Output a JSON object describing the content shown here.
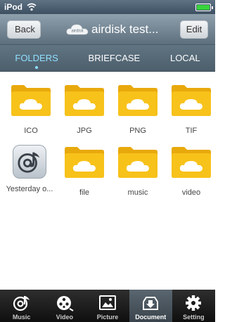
{
  "status_bar": {
    "device": "iPod",
    "battery_level": 1.0
  },
  "nav": {
    "back_label": "Back",
    "title": "airdisk test...",
    "logo_text": "airdisk",
    "edit_label": "Edit"
  },
  "tabs": [
    {
      "label": "FOLDERS",
      "active": true
    },
    {
      "label": "BRIEFCASE",
      "active": false
    },
    {
      "label": "LOCAL",
      "active": false
    }
  ],
  "items": [
    {
      "label": "ICO",
      "icon": "folder-icon"
    },
    {
      "label": "JPG",
      "icon": "folder-icon"
    },
    {
      "label": "PNG",
      "icon": "folder-icon"
    },
    {
      "label": "TIF",
      "icon": "folder-icon"
    },
    {
      "label": "Yesterday o...",
      "icon": "music-file-icon"
    },
    {
      "label": "file",
      "icon": "folder-icon"
    },
    {
      "label": "music",
      "icon": "folder-icon"
    },
    {
      "label": "video",
      "icon": "folder-icon"
    }
  ],
  "bottom_tabs": [
    {
      "label": "Music",
      "icon": "music-icon",
      "active": false
    },
    {
      "label": "Video",
      "icon": "film-reel-icon",
      "active": false
    },
    {
      "label": "Picture",
      "icon": "picture-icon",
      "active": false
    },
    {
      "label": "Document",
      "icon": "download-box-icon",
      "active": true
    },
    {
      "label": "Setting",
      "icon": "gear-icon",
      "active": false
    }
  ],
  "colors": {
    "folder": "#f7c21a",
    "folder_dark": "#e8a90c",
    "active_tab_text": "#8fe0ff"
  }
}
